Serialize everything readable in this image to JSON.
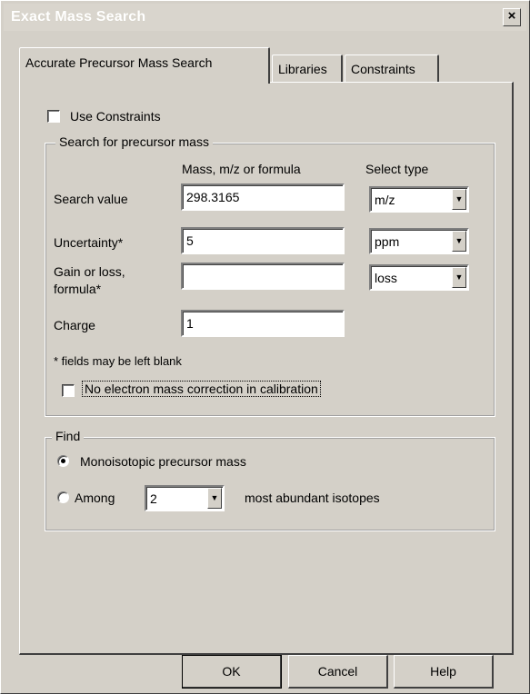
{
  "window": {
    "title": "Exact Mass Search",
    "close_glyph": "×"
  },
  "tabs": [
    {
      "label": "Accurate Precursor Mass Search",
      "active": true
    },
    {
      "label": "Libraries",
      "active": false
    },
    {
      "label": "Constraints",
      "active": false
    }
  ],
  "use_constraints": {
    "label": "Use Constraints",
    "checked": false
  },
  "search_group": {
    "legend": "Search for precursor mass",
    "col_mass": "Mass, m/z or formula",
    "col_type": "Select type",
    "search_value": {
      "label": "Search value",
      "value": "298.3165",
      "type": "m/z"
    },
    "uncertainty": {
      "label": "Uncertainty*",
      "value": "5",
      "type": "ppm"
    },
    "gain_loss": {
      "label_line1": "Gain or loss,",
      "label_line2": "formula*",
      "value": "",
      "type": "loss"
    },
    "charge": {
      "label": "Charge",
      "value": "1"
    },
    "note": "* fields may be left blank",
    "no_electron": {
      "label": "No electron mass correction in calibration",
      "checked": false
    }
  },
  "find_group": {
    "legend": "Find",
    "mono": {
      "label": "Monoisotopic precursor mass",
      "selected": true
    },
    "among": {
      "label": "Among",
      "value": "2",
      "suffix": "most abundant isotopes",
      "selected": false
    }
  },
  "buttons": {
    "ok": "OK",
    "cancel": "Cancel",
    "help": "Help"
  }
}
